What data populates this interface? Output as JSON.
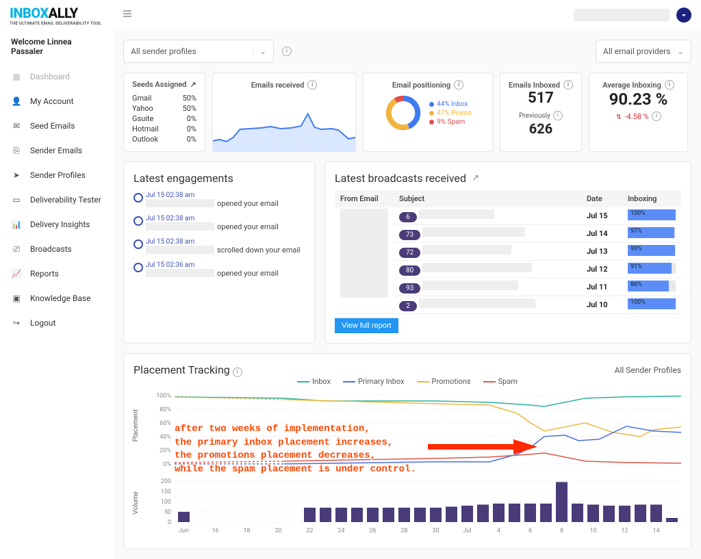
{
  "brand": {
    "part1": "INBOX",
    "part2": "ALLY",
    "tagline": "THE ULTIMATE EMAIL DELIVERABILITY TOOL"
  },
  "welcome": "Welcome Linnea Passaler",
  "nav": [
    {
      "label": "Dashboard",
      "active": true
    },
    {
      "label": "My Account"
    },
    {
      "label": "Seed Emails"
    },
    {
      "label": "Sender Emails"
    },
    {
      "label": "Sender Profiles"
    },
    {
      "label": "Deliverability Tester"
    },
    {
      "label": "Delivery Insights"
    },
    {
      "label": "Broadcasts"
    },
    {
      "label": "Reports"
    },
    {
      "label": "Knowledge Base"
    },
    {
      "label": "Logout"
    }
  ],
  "filters": {
    "sender": "All sender profiles",
    "provider": "All email providers"
  },
  "seeds": {
    "title": "Seeds Assigned",
    "rows": [
      {
        "name": "Gmail",
        "pct": "50%"
      },
      {
        "name": "Yahoo",
        "pct": "50%"
      },
      {
        "name": "Gsuite",
        "pct": "0%"
      },
      {
        "name": "Hotmail",
        "pct": "0%"
      },
      {
        "name": "Outlook",
        "pct": "0%"
      }
    ]
  },
  "emailsReceived": {
    "title": "Emails received"
  },
  "positioning": {
    "title": "Email positioning",
    "items": [
      {
        "label": "44% Inbox",
        "color": "#3f7bf0",
        "pct": 44
      },
      {
        "label": "47% Promo",
        "color": "#f0b43f",
        "pct": 47
      },
      {
        "label": "9% Spam",
        "color": "#e64a4a",
        "pct": 9
      }
    ]
  },
  "inboxed": {
    "title": "Emails Inboxed",
    "value": "517",
    "prevLabel": "Previously",
    "prevValue": "626"
  },
  "avg": {
    "title": "Average Inboxing",
    "value": "90.23 %",
    "delta": "-4.58 %"
  },
  "engagements": {
    "title": "Latest engagements",
    "items": [
      {
        "time": "Jul 15 02:38 am",
        "text": "opened your email"
      },
      {
        "time": "Jul 15 02:38 am",
        "text": "opened your email"
      },
      {
        "time": "Jul 15 02:38 am",
        "text": "scrolled down your email"
      },
      {
        "time": "Jul 15 02:36 am",
        "text": "opened your email"
      }
    ]
  },
  "broadcasts": {
    "title": "Latest broadcasts received",
    "headers": {
      "from": "From Email",
      "subject": "Subject",
      "date": "Date",
      "inboxing": "Inboxing"
    },
    "rows": [
      {
        "count": "6",
        "date": "Jul 15",
        "pct": 100
      },
      {
        "count": "73",
        "date": "Jul 14",
        "pct": 97
      },
      {
        "count": "72",
        "date": "Jul 13",
        "pct": 99
      },
      {
        "count": "80",
        "date": "Jul 12",
        "pct": 91
      },
      {
        "count": "93",
        "date": "Jul 11",
        "pct": 86
      },
      {
        "count": "2",
        "date": "Jul 10",
        "pct": 100
      }
    ],
    "viewFull": "View full report"
  },
  "placement": {
    "title": "Placement Tracking",
    "right": "All Sender Profiles",
    "legend": [
      {
        "name": "Inbox",
        "color": "#2bb39a"
      },
      {
        "name": "Primary Inbox",
        "color": "#4a6fe0"
      },
      {
        "name": "Promotions",
        "color": "#e8b93f"
      },
      {
        "name": "Spam",
        "color": "#e0564a"
      }
    ],
    "yTicksPlacement": [
      "100%",
      "80%",
      "60%",
      "40%",
      "20%",
      "0%"
    ],
    "yTicksVolume": [
      "200",
      "150",
      "100",
      "50",
      "0"
    ],
    "xTicks": [
      "Jun",
      "16",
      "18",
      "20",
      "22",
      "24",
      "26",
      "28",
      "30",
      "Jul",
      "4",
      "6",
      "8",
      "10",
      "12",
      "14"
    ],
    "yLabelPlacement": "Placement",
    "yLabelVolume": "Volume",
    "annotation": [
      "after two weeks of implementation,",
      "the primary inbox placement increases,",
      "the promotions placement decreases,",
      "while the spam placement is under control."
    ]
  },
  "chart_data": {
    "type": "line",
    "title": "Placement Tracking",
    "subcharts": [
      {
        "type": "line",
        "ylabel": "Placement",
        "ylim": [
          0,
          100
        ],
        "x": [
          "Jun 14",
          "Jun 15",
          "Jun 16",
          "Jun 17",
          "Jun 18",
          "Jun 19",
          "Jun 20",
          "Jun 21",
          "Jun 22",
          "Jun 23",
          "Jun 24",
          "Jun 25",
          "Jun 26",
          "Jun 27",
          "Jun 28",
          "Jun 29",
          "Jun 30",
          "Jul 1",
          "Jul 2",
          "Jul 3",
          "Jul 4",
          "Jul 5",
          "Jul 6",
          "Jul 7",
          "Jul 8",
          "Jul 9",
          "Jul 10",
          "Jul 11",
          "Jul 12",
          "Jul 13",
          "Jul 14",
          "Jul 15"
        ],
        "series": [
          {
            "name": "Inbox",
            "color": "#2bb39a",
            "values": [
              98,
              98,
              98,
              97,
              95,
              96,
              95,
              94,
              93,
              92,
              92,
              91,
              92,
              92,
              92,
              92,
              91,
              90,
              90,
              90,
              88,
              86,
              85,
              88,
              94,
              96,
              98,
              97,
              98,
              98,
              99,
              99
            ]
          },
          {
            "name": "Primary Inbox",
            "color": "#4a6fe0",
            "values": [
              0,
              0,
              0,
              0,
              0,
              0,
              0,
              0,
              3,
              3,
              3,
              3,
              3,
              3,
              4,
              4,
              4,
              4,
              4,
              4,
              15,
              24,
              30,
              40,
              42,
              34,
              36,
              50,
              55,
              48,
              46,
              46
            ]
          },
          {
            "name": "Promotions",
            "color": "#e8b93f",
            "values": [
              98,
              97,
              96,
              95,
              94,
              94,
              93,
              92,
              90,
              90,
              90,
              90,
              90,
              89,
              90,
              89,
              88,
              87,
              87,
              87,
              74,
              65,
              58,
              48,
              52,
              60,
              60,
              45,
              40,
              50,
              54,
              54
            ]
          },
          {
            "name": "Spam",
            "color": "#e0564a",
            "values": [
              2,
              2,
              2,
              3,
              4,
              4,
              5,
              6,
              7,
              8,
              8,
              8,
              8,
              8,
              8,
              8,
              9,
              10,
              10,
              10,
              12,
              14,
              15,
              12,
              6,
              4,
              2,
              3,
              2,
              2,
              1,
              1
            ]
          }
        ]
      },
      {
        "type": "bar",
        "ylabel": "Volume",
        "ylim": [
          0,
          200
        ],
        "x": [
          "Jun 14",
          "Jun 15",
          "Jun 16",
          "Jun 17",
          "Jun 18",
          "Jun 19",
          "Jun 20",
          "Jun 21",
          "Jun 22",
          "Jun 23",
          "Jun 24",
          "Jun 25",
          "Jun 26",
          "Jun 27",
          "Jun 28",
          "Jun 29",
          "Jun 30",
          "Jul 1",
          "Jul 2",
          "Jul 3",
          "Jul 4",
          "Jul 5",
          "Jul 6",
          "Jul 7",
          "Jul 8",
          "Jul 9",
          "Jul 10",
          "Jul 11",
          "Jul 12",
          "Jul 13",
          "Jul 14",
          "Jul 15"
        ],
        "values": [
          50,
          0,
          0,
          0,
          0,
          0,
          0,
          0,
          70,
          70,
          70,
          70,
          70,
          70,
          70,
          70,
          70,
          75,
          80,
          85,
          90,
          90,
          90,
          90,
          195,
          90,
          85,
          80,
          80,
          85,
          85,
          20
        ]
      },
      {
        "type": "line",
        "title": "Emails received sparkline",
        "x_range": [
          0,
          30
        ],
        "values": [
          30,
          32,
          28,
          35,
          48,
          50,
          52,
          55,
          52,
          50,
          52,
          58,
          56,
          95,
          60,
          50,
          52,
          48,
          50,
          48,
          30,
          35
        ]
      }
    ],
    "donut": {
      "type": "pie",
      "title": "Email positioning",
      "categories": [
        "Inbox",
        "Promo",
        "Spam"
      ],
      "values": [
        44,
        47,
        9
      ],
      "colors": [
        "#3f7bf0",
        "#f0b43f",
        "#e64a4a"
      ]
    }
  }
}
